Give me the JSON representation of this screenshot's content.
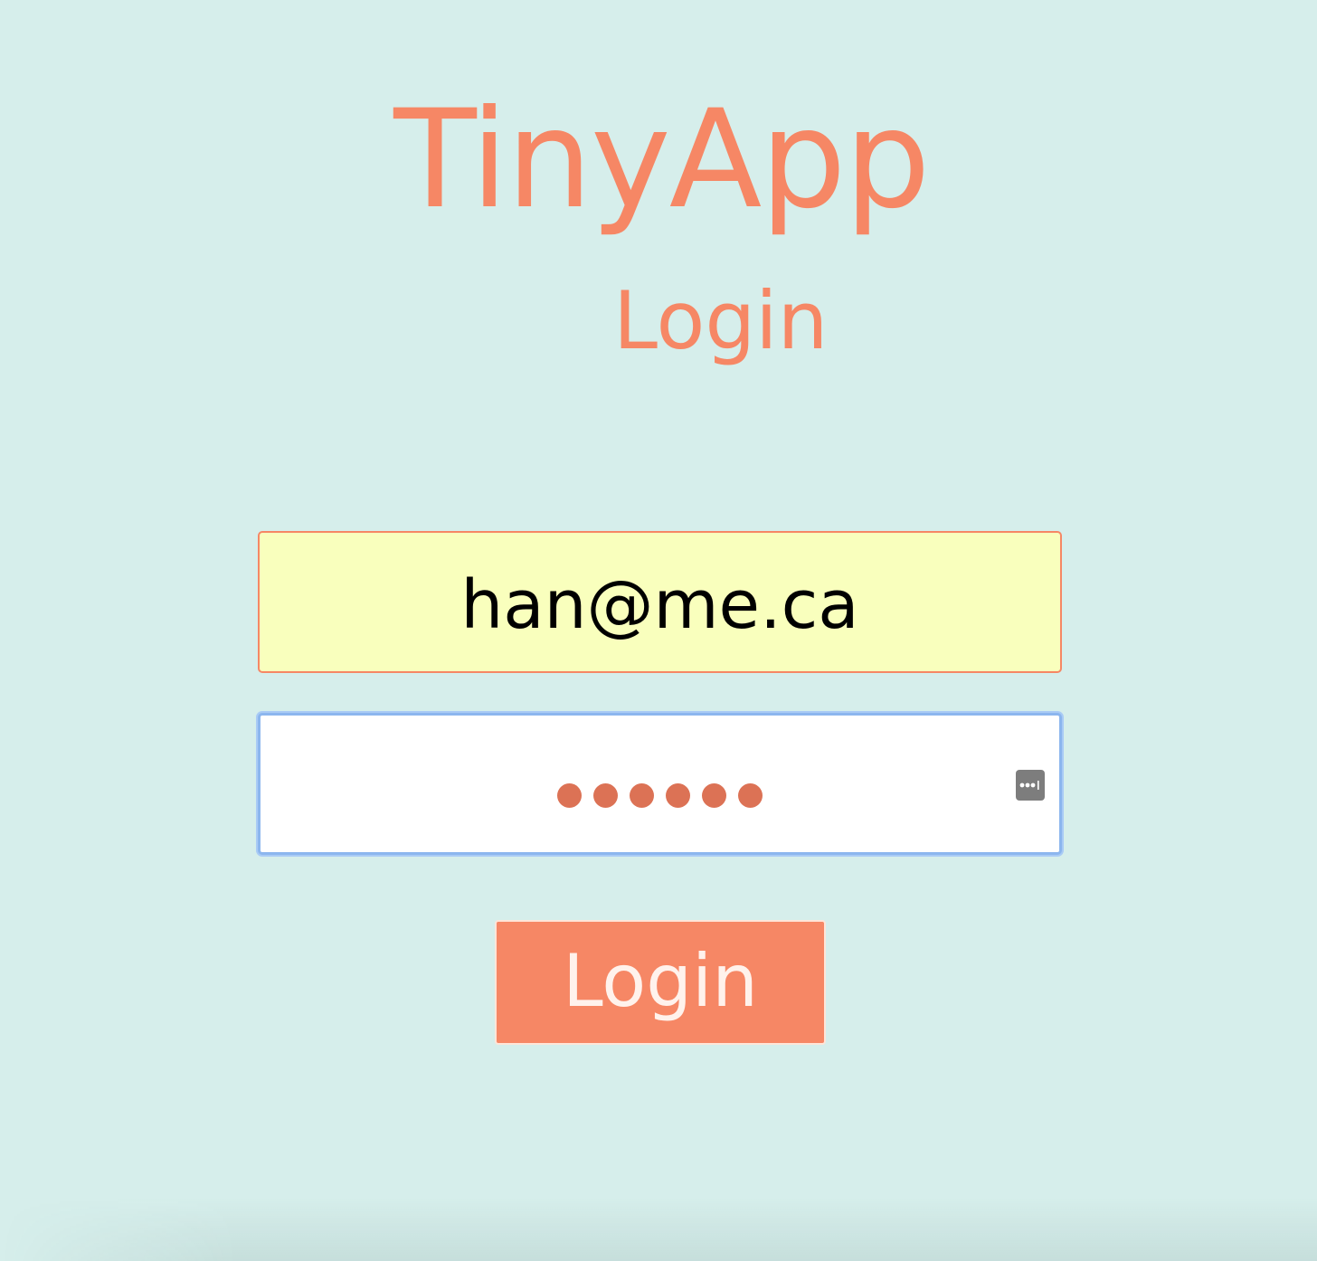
{
  "header": {
    "app_title": "TinyApp",
    "page_title": "Login"
  },
  "form": {
    "email": {
      "value": "han@me.ca"
    },
    "password": {
      "masked_length": 6,
      "autofill_icon": "password-key-icon"
    },
    "submit_label": "Login"
  },
  "colors": {
    "background": "#d6eeeb",
    "accent": "#f68765",
    "email_fill": "#f9ffbd",
    "password_dots": "#dc7255",
    "focus_ring": "#8cb6ee"
  }
}
